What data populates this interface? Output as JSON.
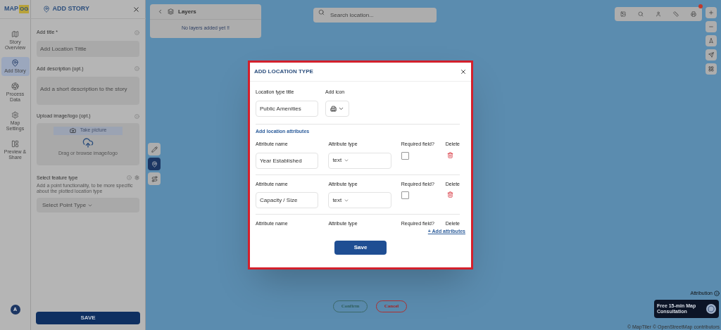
{
  "header": {
    "logo_text": "MAP",
    "logo_badge": "OG",
    "panel_title": "ADD STORY"
  },
  "nav": [
    {
      "kind": "overview",
      "label": "Story Overview",
      "selected": false
    },
    {
      "kind": "add",
      "label": "Add Story",
      "selected": true
    },
    {
      "kind": "process",
      "label": "Process Data",
      "selected": false
    },
    {
      "kind": "settings",
      "label": "Map Settings",
      "selected": false
    },
    {
      "kind": "preview",
      "label": "Preview & Share",
      "selected": false
    }
  ],
  "avatar": "A",
  "form": {
    "title_label": "Add title *",
    "title_placeholder": "Add Location Tittle",
    "description_label": "Add description (opt.)",
    "description_placeholder": "Add a short description to the story",
    "upload_label": "Upload image/logo (opt.)",
    "take_picture": "Take picture",
    "drag_text": "Drag or browse image/logo",
    "feature_label": "Select feature type",
    "feature_help": "Add a point functionality, to be more specific about the plotted location type",
    "feature_select": "Select Point Type",
    "save": "SAVE"
  },
  "layers": {
    "title": "Layers",
    "empty": "No layers added yet !!"
  },
  "search": {
    "placeholder": "Search location..."
  },
  "map_tools": [
    {
      "kind": "draw",
      "selected": false
    },
    {
      "kind": "pin",
      "selected": true
    },
    {
      "kind": "route",
      "selected": false
    }
  ],
  "modal": {
    "title": "ADD LOCATION TYPE",
    "type_title_label": "Location type title",
    "type_title_value": "Public Amenities",
    "icon_label": "Add icon",
    "attributes_heading": "Add location attributes",
    "attributes": [
      {
        "name_label": "Attribute name",
        "name_value": "Year Established",
        "type_label": "Attribute type",
        "type_value": "text",
        "required_label": "Required field?",
        "required": false,
        "delete_label": "Delete"
      },
      {
        "name_label": "Attribute name",
        "name_value": "Capacity / Size",
        "type_label": "Attribute type",
        "type_value": "text",
        "required_label": "Required field?",
        "required": false,
        "delete_label": "Delete"
      },
      {
        "name_label": "Attribute name",
        "type_label": "Attribute type",
        "required_label": "Required field?",
        "delete_label": "Delete"
      }
    ],
    "add_link": "+ Add attributes",
    "save": "Save"
  },
  "confirm": "Confirm",
  "cancel": "Cancel",
  "attribution": "Attribution",
  "consultation": "Free 15-min Map Consultation",
  "credits": "© MapTiler © OpenStreetMap contributors"
}
